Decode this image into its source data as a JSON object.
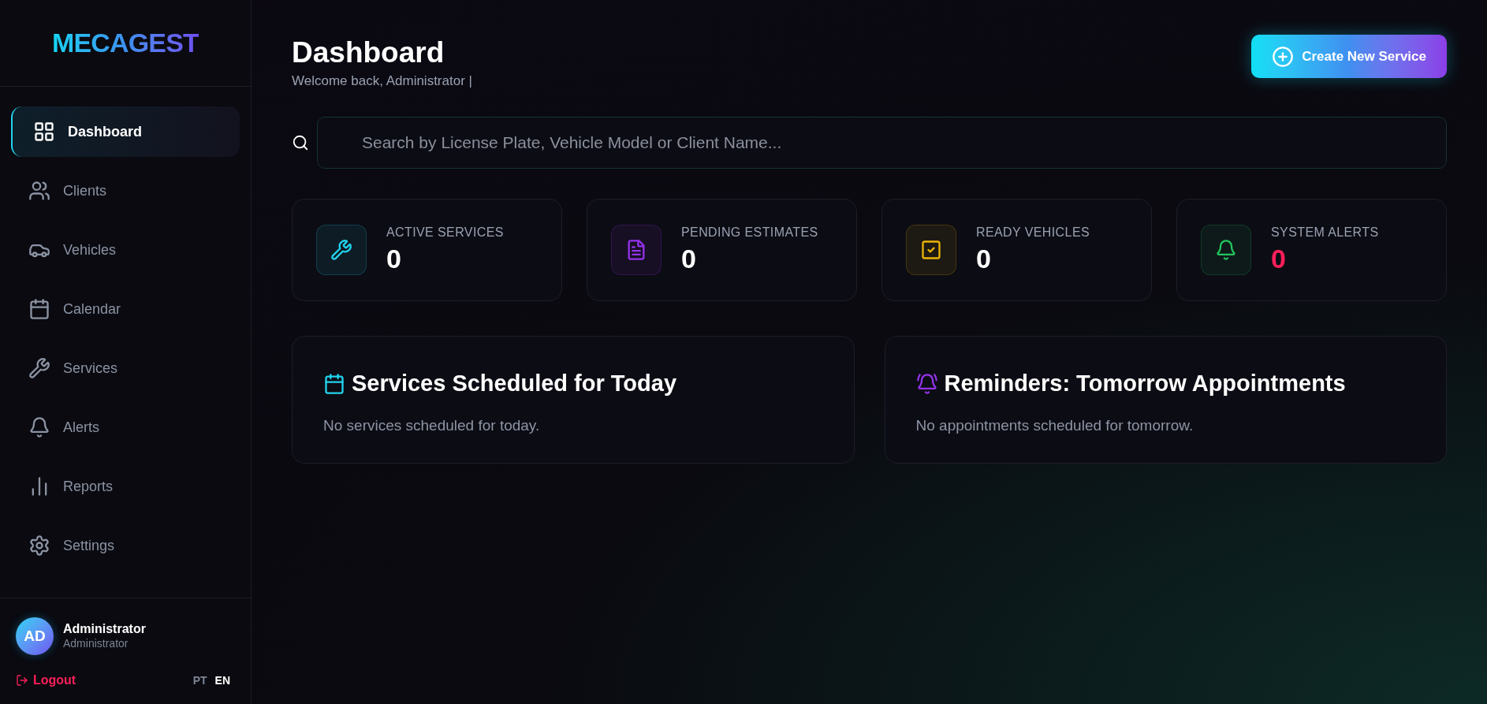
{
  "sidebar": {
    "logo": "MECAGEST",
    "items": [
      {
        "label": "Dashboard",
        "selected": true
      },
      {
        "label": "Clients",
        "selected": false
      },
      {
        "label": "Vehicles",
        "selected": false
      },
      {
        "label": "Calendar",
        "selected": false
      },
      {
        "label": "Services",
        "selected": false
      },
      {
        "label": "Alerts",
        "selected": false
      },
      {
        "label": "Reports",
        "selected": false
      },
      {
        "label": "Settings",
        "selected": false
      }
    ],
    "user": {
      "initials": "AD",
      "name": "Administrator",
      "role": "Administrator"
    },
    "logout": "Logout",
    "languages": [
      {
        "label": "PT",
        "selected": false
      },
      {
        "label": "EN",
        "selected": true
      }
    ]
  },
  "header": {
    "title": "Dashboard",
    "subtitle": "Welcome back, Administrator |",
    "button": "Create New Service"
  },
  "search": {
    "placeholder": "Search by License Plate, Vehicle Model or Client Name..."
  },
  "stats": [
    {
      "label": "ACTIVE SERVICES",
      "value": "0",
      "color": "#22d3ee",
      "kind": "normal"
    },
    {
      "label": "PENDING ESTIMATES",
      "value": "0",
      "color": "#9333ea",
      "kind": "normal"
    },
    {
      "label": "READY VEHICLES",
      "value": "0",
      "color": "#eab308",
      "kind": "normal"
    },
    {
      "label": "SYSTEM ALERTS",
      "value": "0",
      "color": "#22c55e",
      "kind": "alert"
    }
  ],
  "panels": [
    {
      "title": "Services Scheduled for Today",
      "color": "#22d3ee",
      "message": "No services scheduled for today."
    },
    {
      "title": "Reminders: Tomorrow Appointments",
      "color": "#9333ea",
      "message": "No appointments scheduled for tomorrow."
    }
  ]
}
